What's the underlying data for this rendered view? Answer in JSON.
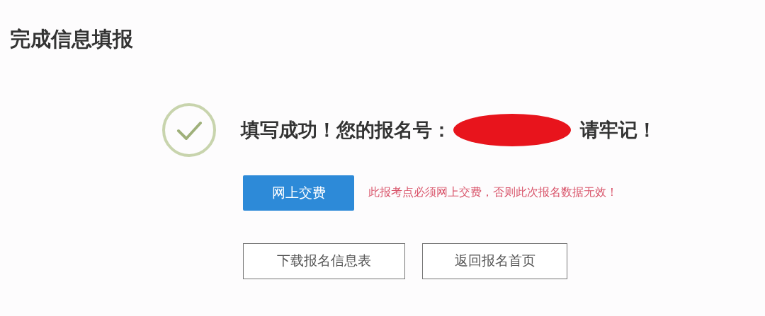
{
  "page_title": "完成信息填报",
  "result": {
    "message": "填写成功！您的报名号：",
    "reminder": "请牢记！"
  },
  "pay_button": "网上交费",
  "warning": "此报考点必须网上交费，否则此次报名数据无效！",
  "buttons": [
    "下载报名信息表",
    "返回报名首页"
  ]
}
